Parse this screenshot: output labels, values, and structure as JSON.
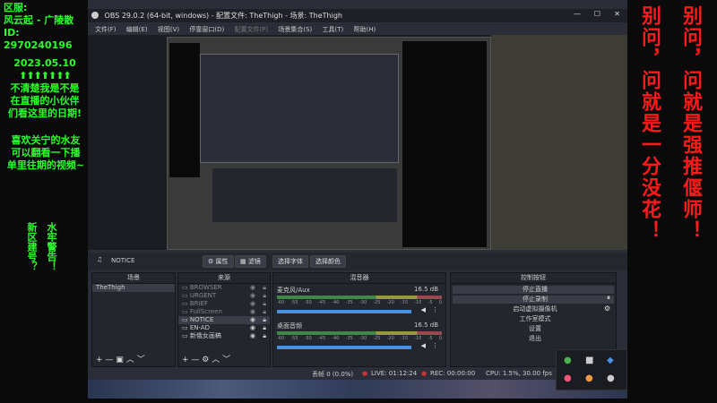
{
  "overlay_left": {
    "server_lines": [
      "区服:",
      "风云起 - 广陵散",
      "ID: 2970240196"
    ],
    "date": "2023.05.10",
    "arrows": "⬆⬆⬆⬆⬆⬆⬆",
    "note_lines": [
      "不清楚我是不是",
      "在直播的小伙伴",
      "们看这里的日期!"
    ],
    "promo_lines": [
      "喜欢关宁的水友",
      "可以翻看一下播",
      "单里往期的视频~"
    ],
    "vert_col1": "新区建号？",
    "vert_col2": "水牢警告！"
  },
  "overlay_right": {
    "col1": "别问，问就是一分没花！",
    "col2": "别问，问就是强推偃师！"
  },
  "obs": {
    "title": "OBS 29.0.2 (64-bit, windows) - 配置文件: TheThigh - 场景: TheThigh",
    "menu": [
      "文件(F)",
      "编辑(E)",
      "视图(V)",
      "停靠窗口(D)",
      "配置文件(P)",
      "场景集合(S)",
      "工具(T)",
      "帮助(H)"
    ],
    "source_name": "NOTICE",
    "ctrl_buttons": [
      "属性",
      "滤镜",
      "选择字体",
      "选择颜色"
    ],
    "scenes_title": "场景",
    "scenes": [
      "TheThigh"
    ],
    "sources_title": "来源",
    "sources": [
      "BROWSER",
      "URGENT",
      "BRIEF",
      "FullScreen",
      "NOTICE",
      "EN-AD",
      "新俄女画稿"
    ],
    "mixer_title": "混音器",
    "mixer": [
      {
        "name": "麦克风/Aux",
        "level": "16.5 dB"
      },
      {
        "name": "桌面音频",
        "level": "16.5 dB"
      }
    ],
    "scale_ticks": [
      "-60",
      "-55",
      "-50",
      "-45",
      "-40",
      "-35",
      "-30",
      "-25",
      "-20",
      "-15",
      "-10",
      "-5",
      "0"
    ],
    "controls_title": "控制按钮",
    "controls": [
      "停止直播",
      "停止录制",
      "启动虚拟摄像机",
      "工作室模式",
      "设置",
      "退出"
    ],
    "status": {
      "dropped": "丢帧 0 (0.0%)",
      "live": "LIVE: 01:12:24",
      "rec": "REC: 00:00:00",
      "cpu": "CPU: 1.5%, 30.00 fps"
    }
  }
}
